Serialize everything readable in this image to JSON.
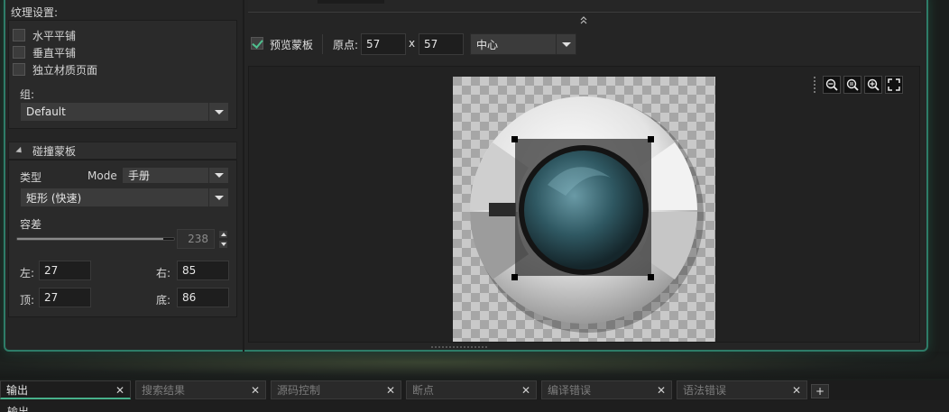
{
  "left_panel": {
    "texture_settings_label": "纹理设置:",
    "checkboxes": [
      {
        "label": "水平平铺",
        "checked": false
      },
      {
        "label": "垂直平铺",
        "checked": false
      },
      {
        "label": "独立材质页面",
        "checked": false
      }
    ],
    "group_label": "组:",
    "group_value": "Default",
    "collision": {
      "header": "碰撞蒙板",
      "type_label": "类型",
      "mode_label": "Mode",
      "mode_value": "手册",
      "shape_value": "矩形 (快速)",
      "tolerance_label": "容差",
      "tolerance_value": "238",
      "tolerance_fraction": 0.93,
      "left_label": "左:",
      "left_value": "27",
      "right_label": "右:",
      "right_value": "85",
      "top_label": "顶:",
      "top_value": "27",
      "bottom_label": "底:",
      "bottom_value": "86"
    }
  },
  "toolbar": {
    "preview_mask_label": "预览蒙板",
    "preview_mask_checked": true,
    "origin_label": "原点:",
    "origin_x": "57",
    "separator": "x",
    "origin_y": "57",
    "origin_mode": "中心"
  },
  "zoom_icons": [
    "zoom-out-icon",
    "zoom-reset-icon",
    "zoom-in-icon",
    "fit-screen-icon"
  ],
  "bottom_tabs": [
    {
      "label": "输出",
      "active": true
    },
    {
      "label": "搜索结果",
      "active": false
    },
    {
      "label": "源码控制",
      "active": false
    },
    {
      "label": "断点",
      "active": false
    },
    {
      "label": "编译错误",
      "active": false
    },
    {
      "label": "语法错误",
      "active": false
    }
  ],
  "tab_add_label": "+",
  "output_header": "输出",
  "colors": {
    "accent": "#47b08a",
    "frame_border": "#2e7c68",
    "panel_bg": "#2a2a2a"
  }
}
